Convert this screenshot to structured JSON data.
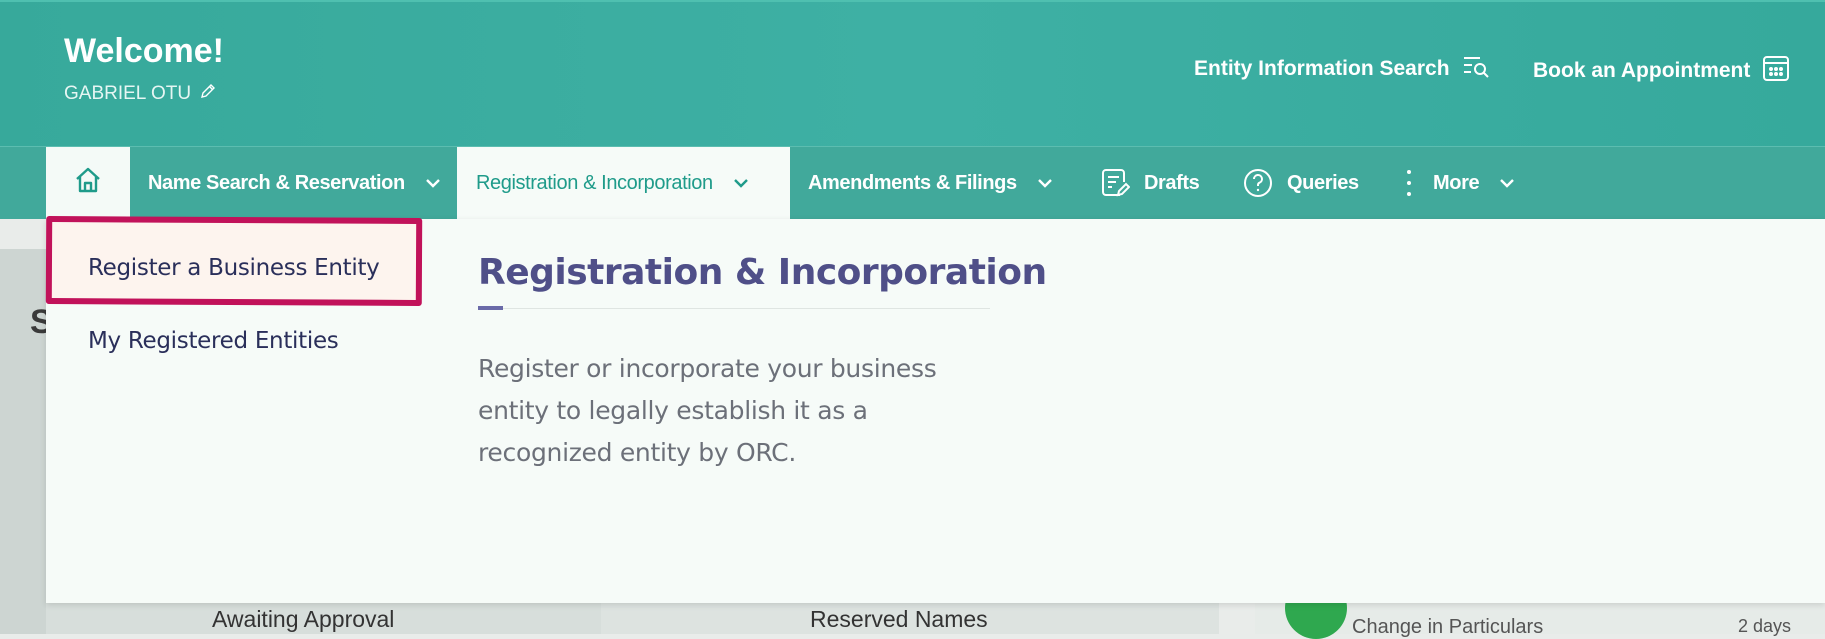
{
  "header": {
    "welcome": "Welcome!",
    "username": "GABRIEL OTU",
    "entity_search": "Entity Information Search",
    "book_appointment": "Book an Appointment"
  },
  "nav": {
    "name_search": "Name Search & Reservation",
    "registration": "Registration & Incorporation",
    "amendments": "Amendments & Filings",
    "drafts": "Drafts",
    "queries": "Queries",
    "more": "More"
  },
  "dropdown": {
    "items": [
      "Register a Business Entity",
      "My Registered Entities"
    ],
    "title": "Registration & Incorporation",
    "description": "Register or incorporate your business entity to legally establish it as a recognized entity by ORC."
  },
  "background": {
    "partial_letter": "S",
    "awaiting_approval": "Awaiting Approval",
    "reserved_names": "Reserved Names",
    "change_in_particulars": "Change in Particulars",
    "two_days": "2 days"
  },
  "colors": {
    "header": "#3eb0a4",
    "nav_active_text": "#1f9b8a",
    "highlight": "#c1125a",
    "title": "#4f4f88"
  }
}
